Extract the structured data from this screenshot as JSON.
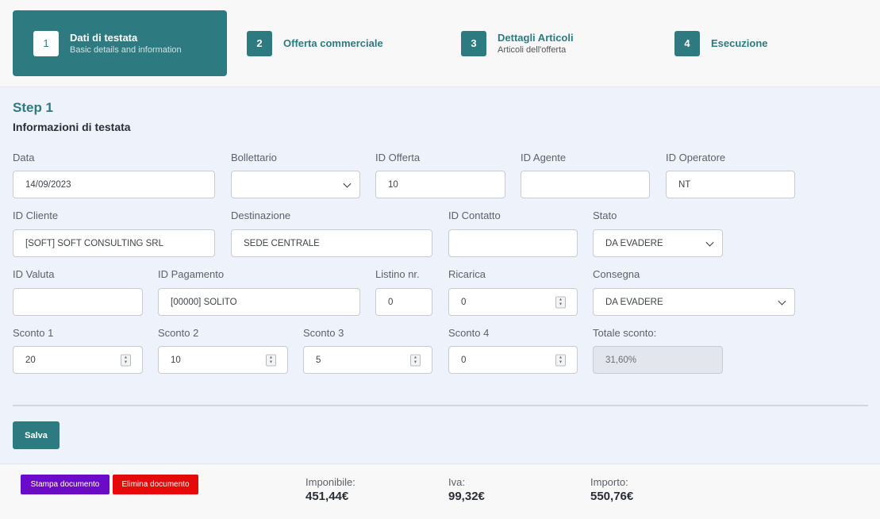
{
  "stepper": {
    "steps": [
      {
        "num": "1",
        "title": "Dati di testata",
        "subtitle": "Basic details and information"
      },
      {
        "num": "2",
        "title": "Offerta commerciale",
        "subtitle": ""
      },
      {
        "num": "3",
        "title": "Dettagli Articoli",
        "subtitle": "Articoli dell'offerta"
      },
      {
        "num": "4",
        "title": "Esecuzione",
        "subtitle": ""
      }
    ],
    "active_step": 1
  },
  "form": {
    "step_label": "Step 1",
    "section_title": "Informazioni di testata",
    "data": {
      "label": "Data",
      "value": "14/09/2023"
    },
    "bollettario": {
      "label": "Bollettario",
      "value": ""
    },
    "id_offerta": {
      "label": "ID Offerta",
      "value": "10"
    },
    "id_agente": {
      "label": "ID Agente",
      "value": ""
    },
    "id_operatore": {
      "label": "ID Operatore",
      "value": "NT"
    },
    "id_cliente": {
      "label": "ID Cliente",
      "value": "[SOFT] SOFT CONSULTING SRL"
    },
    "destinazione": {
      "label": "Destinazione",
      "value": "SEDE CENTRALE"
    },
    "id_contatto": {
      "label": "ID Contatto",
      "value": ""
    },
    "stato": {
      "label": "Stato",
      "value": "DA EVADERE"
    },
    "id_valuta": {
      "label": "ID Valuta",
      "value": ""
    },
    "id_pagamento": {
      "label": "ID Pagamento",
      "value": "[00000] SOLITO"
    },
    "listino": {
      "label": "Listino nr.",
      "value": "0"
    },
    "ricarica": {
      "label": "Ricarica",
      "value": "0"
    },
    "consegna": {
      "label": "Consegna",
      "value": "DA EVADERE"
    },
    "sconto1": {
      "label": "Sconto 1",
      "value": "20"
    },
    "sconto2": {
      "label": "Sconto 2",
      "value": "10"
    },
    "sconto3": {
      "label": "Sconto 3",
      "value": "5"
    },
    "sconto4": {
      "label": "Sconto 4",
      "value": "0"
    },
    "totale_sconto": {
      "label": "Totale sconto:",
      "value": "31,60%"
    },
    "save_label": "Salva"
  },
  "footer": {
    "print_label": "Stampa documento",
    "delete_label": "Elimina documento",
    "imponibile": {
      "label": "Imponibile:",
      "value": "451,44€"
    },
    "iva": {
      "label": "Iva:",
      "value": "99,32€"
    },
    "importo": {
      "label": "Importo:",
      "value": "550,76€"
    }
  },
  "colors": {
    "primary": "#2d7b80",
    "print": "#6c0ac9",
    "delete": "#e40a0a",
    "background": "#eef2fb"
  }
}
